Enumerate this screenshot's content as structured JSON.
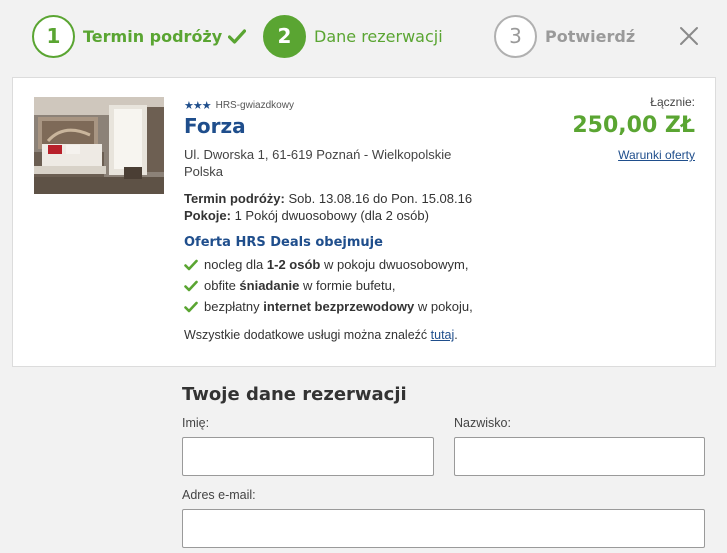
{
  "steps": [
    {
      "number": "1",
      "label": "Termin podróży"
    },
    {
      "number": "2",
      "label": "Dane rezerwacji"
    },
    {
      "number": "3",
      "label": "Potwierdź"
    }
  ],
  "hotel": {
    "stars_label": "HRS-gwiazdkowy",
    "star_count": 3,
    "name": "Forza",
    "address_line1": "Ul. Dworska 1, 61-619 Poznań - Wielkopolskie",
    "address_line2": "Polska",
    "travel_label": "Termin podróży:",
    "travel_value": " Sob. 13.08.16 do Pon. 15.08.16",
    "rooms_label": "Pokoje:",
    "rooms_value": " 1 Pokój dwuosobowy (dla 2 osób)"
  },
  "deal": {
    "title": "Oferta HRS Deals obejmuje",
    "items": [
      {
        "a": "nocleg dla ",
        "b": "1-2 osób",
        "c": " w pokoju dwuosobowym,"
      },
      {
        "a": "obfite ",
        "b": "śniadanie",
        "c": " w formie bufetu,"
      },
      {
        "a": "bezpłatny ",
        "b": "internet bezprzewodowy",
        "c": " w pokoju,"
      }
    ],
    "extras_text": "Wszystkie dodatkowe usługi można znaleźć ",
    "extras_link": "tutaj",
    "extras_end": "."
  },
  "price": {
    "total_label": "Łącznie:",
    "amount": "250,00 ZŁ",
    "terms_link": "Warunki oferty"
  },
  "form": {
    "title": "Twoje dane rezerwacji",
    "first_name_label": "Imię:",
    "first_name_value": "",
    "last_name_label": "Nazwisko:",
    "last_name_value": "",
    "email_label": "Adres e-mail:",
    "email_value": ""
  },
  "colors": {
    "green": "#5aa532",
    "blue": "#1f4e8c",
    "grey": "#9a9a9a"
  }
}
